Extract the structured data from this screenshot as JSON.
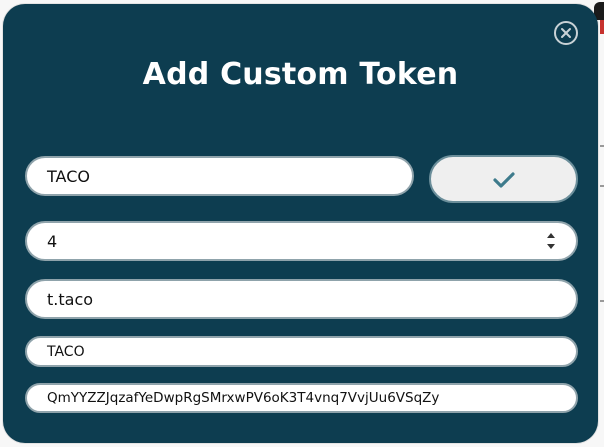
{
  "modal": {
    "title": "Add Custom Token",
    "close_icon": "close-circle-icon",
    "confirm_icon": "checkmark-icon",
    "accent_color": "#0d3d50",
    "check_color": "#3e7b8c"
  },
  "form": {
    "symbol_value": "TACO",
    "decimals_value": "4",
    "contract_value": "t.taco",
    "name_value": "TACO",
    "hash_value": "QmYYZZJqzafYeDwpRgSMrxwPV6oK3T4vnq7VvjUu6VSqZy"
  }
}
